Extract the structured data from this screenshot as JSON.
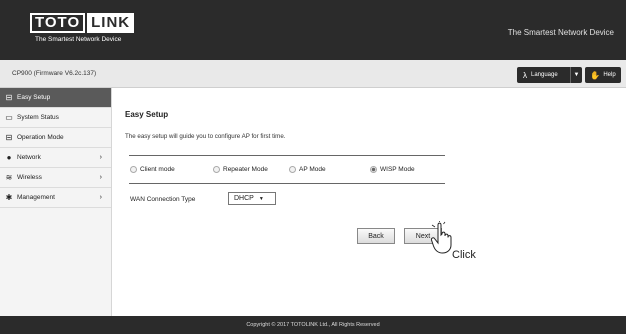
{
  "header": {
    "logo_left": "TOTO",
    "logo_right": "LINK",
    "logo_tagline": "The Smartest Network Device",
    "slogan": "The Smartest Network Device"
  },
  "subbar": {
    "firmware": "CP900 (Firmware V6.2c.137)",
    "language_label": "Language",
    "help_label": "Help"
  },
  "sidebar": {
    "items": [
      {
        "label": "Easy Setup",
        "icon": "setup-icon",
        "active": true
      },
      {
        "label": "System Status",
        "icon": "monitor-icon"
      },
      {
        "label": "Operation Mode",
        "icon": "mode-icon"
      },
      {
        "label": "Network",
        "icon": "globe-icon",
        "arrow": "›"
      },
      {
        "label": "Wireless",
        "icon": "wifi-icon",
        "arrow": "›"
      },
      {
        "label": "Management",
        "icon": "gear-icon",
        "arrow": "›"
      }
    ]
  },
  "main": {
    "title": "Easy Setup",
    "description": "The easy setup will guide you to configure AP for first time.",
    "modes": [
      {
        "label": "Client mode",
        "selected": false
      },
      {
        "label": "Repeater Mode",
        "selected": false
      },
      {
        "label": "AP Mode",
        "selected": false
      },
      {
        "label": "WISP Mode",
        "selected": true
      }
    ],
    "wan_label": "WAN Connection Type",
    "wan_value": "DHCP",
    "back_label": "Back",
    "next_label": "Next",
    "annotation": "Click"
  },
  "footer": {
    "copyright": "Copyright © 2017 TOTOLINK Ltd., All Rights Reserved"
  },
  "colors": {
    "header_bg": "#2b2b2b",
    "active_item_bg": "#5a5a5a"
  }
}
